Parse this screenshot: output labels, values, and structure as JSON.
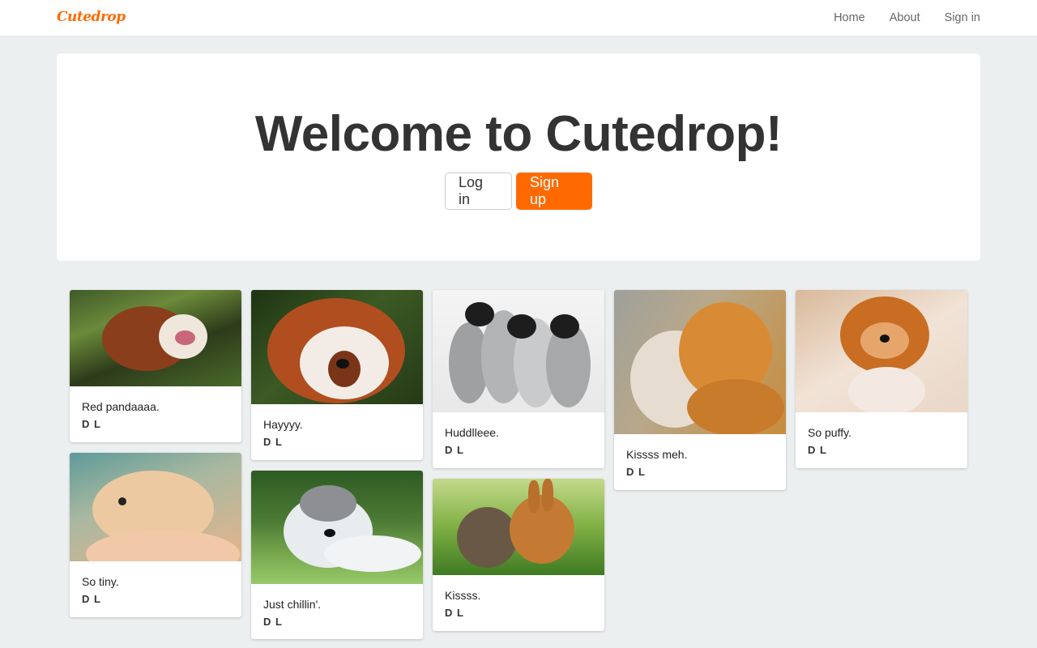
{
  "brand": "Cutedrop",
  "nav": {
    "home": "Home",
    "about": "About",
    "signin": "Sign in"
  },
  "hero": {
    "title": "Welcome to Cutedrop!",
    "login_label": "Log in",
    "signup_label": "Sign up"
  },
  "colors": {
    "accent": "#ff6a00",
    "background": "#ecefef"
  },
  "posts": [
    {
      "caption": "Red pandaaaa.",
      "author": "D L",
      "image": "red-panda-sleeping"
    },
    {
      "caption": "Hayyyy.",
      "author": "D L",
      "image": "red-panda-closeup"
    },
    {
      "caption": "Huddlleee.",
      "author": "D L",
      "image": "penguin-chicks"
    },
    {
      "caption": "Kissss meh.",
      "author": "D L",
      "image": "kittens"
    },
    {
      "caption": "So puffy.",
      "author": "D L",
      "image": "pomeranian"
    },
    {
      "caption": "So tiny.",
      "author": "D L",
      "image": "hamster"
    },
    {
      "caption": "Just chillin'.",
      "author": "D L",
      "image": "husky-puppy"
    },
    {
      "caption": "Kissss.",
      "author": "D L",
      "image": "bunnies"
    }
  ]
}
